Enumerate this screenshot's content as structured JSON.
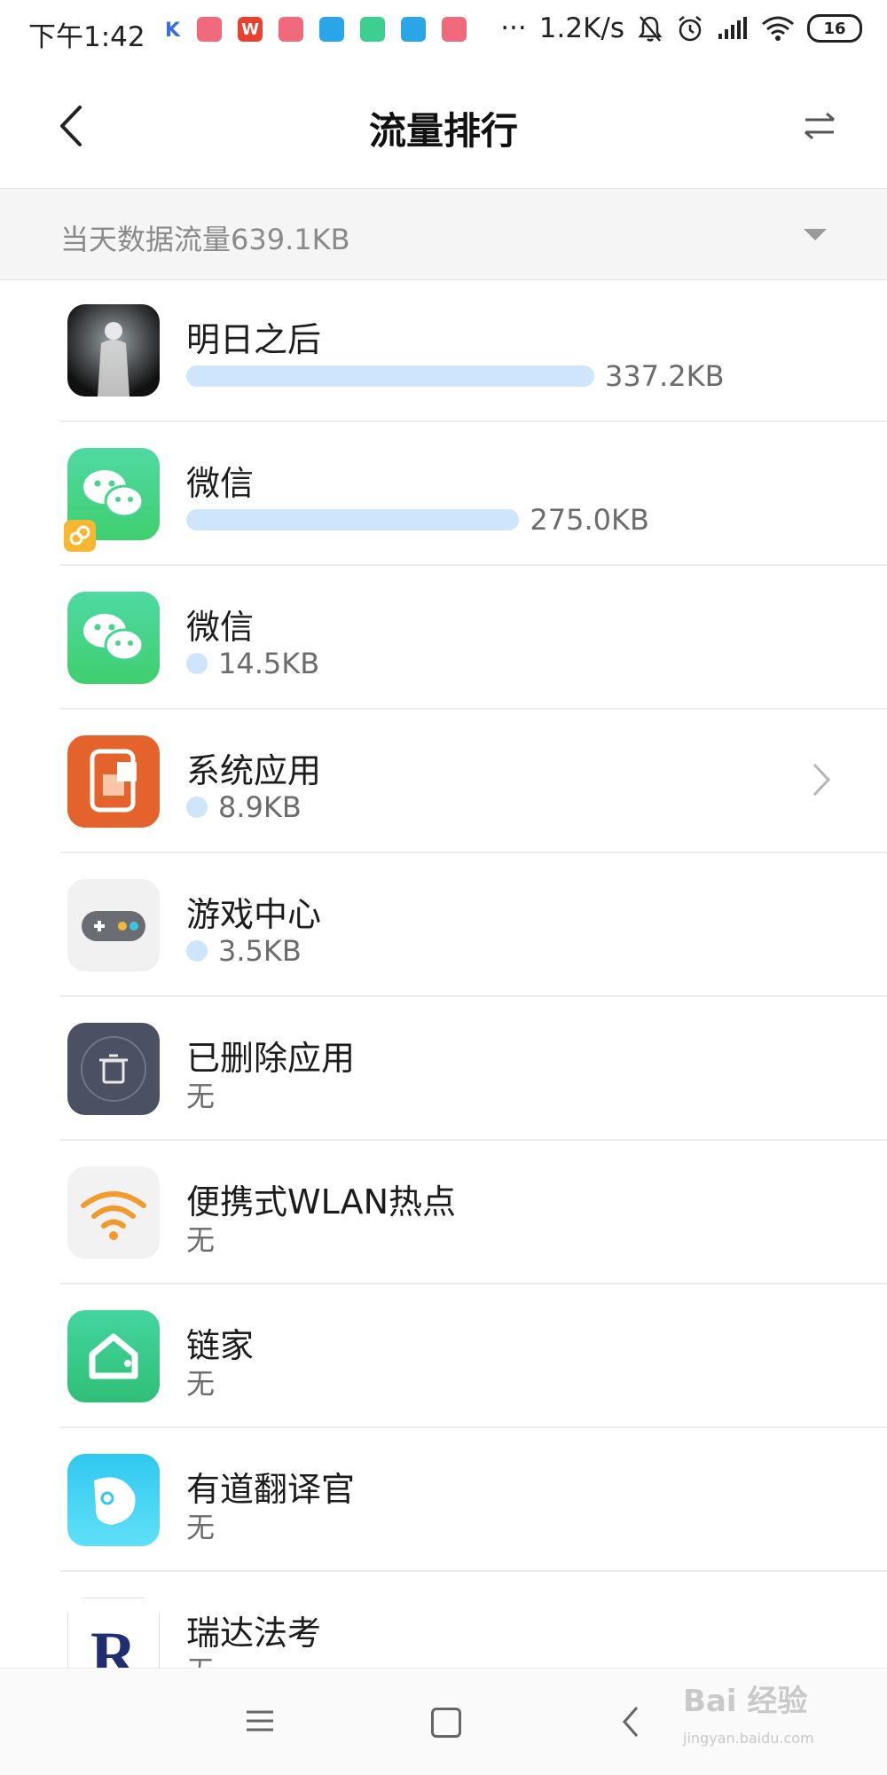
{
  "status_bar": {
    "time": "下午1:42",
    "k_label": "K",
    "notifications": [
      {
        "icon": "chart-app-icon",
        "color": "#f06a7c",
        "glyph": ""
      },
      {
        "icon": "wps-icon",
        "color": "#e8412f",
        "glyph": "W"
      },
      {
        "icon": "chart-app-icon",
        "color": "#f06a7c",
        "glyph": ""
      },
      {
        "icon": "baidu-paw-icon",
        "color": "#2aa6e8",
        "glyph": ""
      },
      {
        "icon": "lianjia-home-icon",
        "color": "#3dcf8e",
        "glyph": ""
      },
      {
        "icon": "baidu-paw-icon",
        "color": "#2aa6e8",
        "glyph": ""
      },
      {
        "icon": "chart-app-icon",
        "color": "#f06a7c",
        "glyph": ""
      }
    ],
    "more": "···",
    "speed": "1.2K/s",
    "battery": "16"
  },
  "header": {
    "title": "流量排行"
  },
  "summary": {
    "text": "当天数据流量639.1KB"
  },
  "apps": [
    {
      "name": "明日之后",
      "usage": "337.2KB",
      "bar_fraction": 1.0,
      "icon": "game-figure-icon",
      "has_chevron": false
    },
    {
      "name": "微信",
      "usage": "275.0KB",
      "bar_fraction": 0.816,
      "icon": "wechat-dual-icon",
      "has_chevron": false
    },
    {
      "name": "微信",
      "usage": "14.5KB",
      "bar_fraction": 0.043,
      "icon": "wechat-icon",
      "has_chevron": false
    },
    {
      "name": "系统应用",
      "usage": "8.9KB",
      "bar_fraction": 0.026,
      "icon": "system-apps-icon",
      "has_chevron": true
    },
    {
      "name": "游戏中心",
      "usage": "3.5KB",
      "bar_fraction": 0.01,
      "icon": "gamepad-icon",
      "has_chevron": false
    },
    {
      "name": "已删除应用",
      "usage": "无",
      "bar_fraction": 0,
      "icon": "trash-icon",
      "has_chevron": false
    },
    {
      "name": "便携式WLAN热点",
      "usage": "无",
      "bar_fraction": 0,
      "icon": "hotspot-wifi-icon",
      "has_chevron": false
    },
    {
      "name": "链家",
      "usage": "无",
      "bar_fraction": 0,
      "icon": "lianjia-icon",
      "has_chevron": false
    },
    {
      "name": "有道翻译官",
      "usage": "无",
      "bar_fraction": 0,
      "icon": "youdao-icon",
      "has_chevron": false
    },
    {
      "name": "瑞达法考",
      "usage": "无",
      "bar_fraction": 0,
      "icon": "ruida-icon",
      "has_chevron": false
    }
  ],
  "watermark": {
    "text": "Bai 经验",
    "sub": "jingyan.baidu.com"
  },
  "colors": {
    "bar": "#cfe5fb",
    "summary_bg": "#f5f5f5"
  }
}
